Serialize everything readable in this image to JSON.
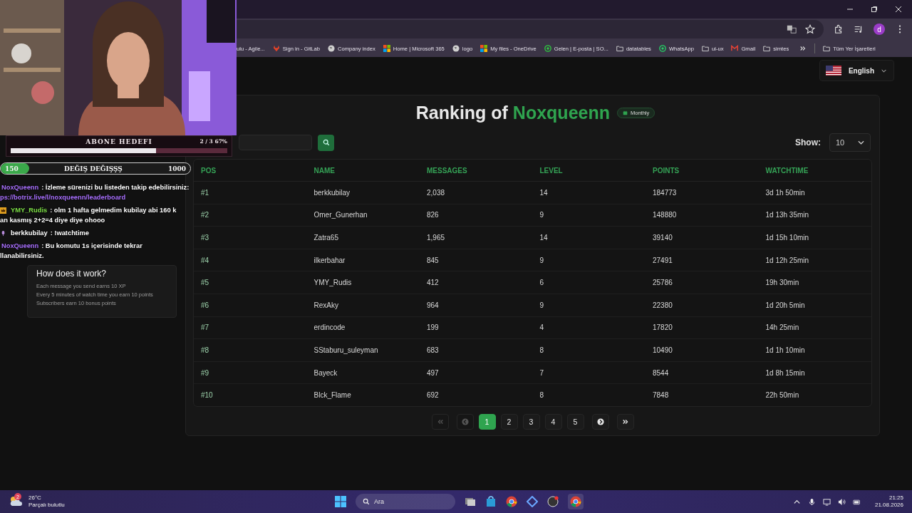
{
  "browser": {
    "profile_initial": "d",
    "bookmarks": [
      {
        "label": "ulu - Agile...",
        "kind": "none"
      },
      {
        "label": "Sign in - GitLab",
        "kind": "gitlab"
      },
      {
        "label": "Company index",
        "kind": "globe"
      },
      {
        "label": "Home | Microsoft 365",
        "kind": "microsoft"
      },
      {
        "label": "logo",
        "kind": "globe"
      },
      {
        "label": "My files - OneDrive",
        "kind": "microsoft"
      },
      {
        "label": "Gelen | E-posta | SO...",
        "kind": "status"
      },
      {
        "label": "datatables",
        "kind": "folder"
      },
      {
        "label": "WhatsApp",
        "kind": "whatsapp"
      },
      {
        "label": "ui-ux",
        "kind": "folder"
      },
      {
        "label": "Gmail",
        "kind": "gmail"
      },
      {
        "label": "simtes",
        "kind": "folder"
      }
    ],
    "all_bookmarks": "Tüm Yer İşaretleri"
  },
  "stream": {
    "goal": {
      "title": "ABONE HEDEFI",
      "count": "2 / 3",
      "percent": "67%",
      "level": 0.67
    },
    "bar": {
      "start": "150",
      "label": "DEĞIŞ DEĞIŞŞŞ",
      "end": "1000",
      "level": 0.15
    },
    "chat": [
      {
        "user": "NoxQueenn",
        "color": "#a970ff",
        "kind": "plain",
        "lines": [
          ": İzleme sürenizi bu listeden takip edebilirsiniz:"
        ],
        "link": "ps://botrix.live/l/noxqueenn/leaderboard"
      },
      {
        "user": "YMY_Rudis",
        "color": "#7ee047",
        "kind": "crown",
        "lines": [
          ": olm 1 hafta gelmedim kubilay abi 160 k",
          "an kasmış 2+2=4 diye diye ohooo"
        ]
      },
      {
        "user": "berkkubilay",
        "color": "#ffffff",
        "kind": "mic",
        "lines": [
          ": !watchtime"
        ]
      },
      {
        "user": "NoxQueenn",
        "color": "#a970ff",
        "kind": "plain",
        "lines": [
          ": Bu komutu 1s içerisinde tekrar",
          "llanabilirsiniz."
        ]
      }
    ]
  },
  "info_card": {
    "title": "How does it work?",
    "lines": [
      "Each message you send earns 10 XP",
      "Every 5 minutes of watch time you earn 10 points",
      "Subscribers earn 10 bonus points"
    ]
  },
  "language": "English",
  "ranking": {
    "title": "Ranking of",
    "name": "Noxqueenn",
    "period": "Monthly"
  },
  "show": {
    "label": "Show:",
    "value": "10"
  },
  "table": {
    "columns": [
      "POS",
      "NAME",
      "MESSAGES",
      "LEVEL",
      "POINTS",
      "WATCHTIME"
    ],
    "rows": [
      [
        "#1",
        "berkkubilay",
        "2,038",
        "14",
        "184773",
        "3d 1h 50min"
      ],
      [
        "#2",
        "Omer_Gunerhan",
        "826",
        "9",
        "148880",
        "1d 13h 35min"
      ],
      [
        "#3",
        "Zatra65",
        "1,965",
        "14",
        "39140",
        "1d 15h 10min"
      ],
      [
        "#4",
        "ilkerbahar",
        "845",
        "9",
        "27491",
        "1d 12h 25min"
      ],
      [
        "#5",
        "YMY_Rudis",
        "412",
        "6",
        "25786",
        "19h 30min"
      ],
      [
        "#6",
        "RexAky",
        "964",
        "9",
        "22380",
        "1d 20h 5min"
      ],
      [
        "#7",
        "erdincode",
        "199",
        "4",
        "17820",
        "14h 25min"
      ],
      [
        "#8",
        "SStaburu_suleyman",
        "683",
        "8",
        "10490",
        "1d 1h 10min"
      ],
      [
        "#9",
        "Bayeck",
        "497",
        "7",
        "8544",
        "1d 8h 15min"
      ],
      [
        "#10",
        "Blck_Flame",
        "692",
        "8",
        "7848",
        "22h 50min"
      ]
    ]
  },
  "pagination": {
    "first": {
      "disabled": true
    },
    "prev": {
      "disabled": true
    },
    "pages": [
      {
        "label": "1",
        "selected": true
      },
      {
        "label": "2",
        "selected": false
      },
      {
        "label": "3",
        "selected": false
      },
      {
        "label": "4",
        "selected": false
      },
      {
        "label": "5",
        "selected": false
      }
    ],
    "next": {
      "disabled": false
    },
    "last": {
      "disabled": false
    }
  },
  "taskbar": {
    "weather": {
      "temp": "26°C",
      "desc": "Parçalı bulutlu",
      "badge": "2"
    },
    "search": {
      "placeholder": "Ara"
    },
    "time": "21:25",
    "date": "21.08.2026"
  }
}
